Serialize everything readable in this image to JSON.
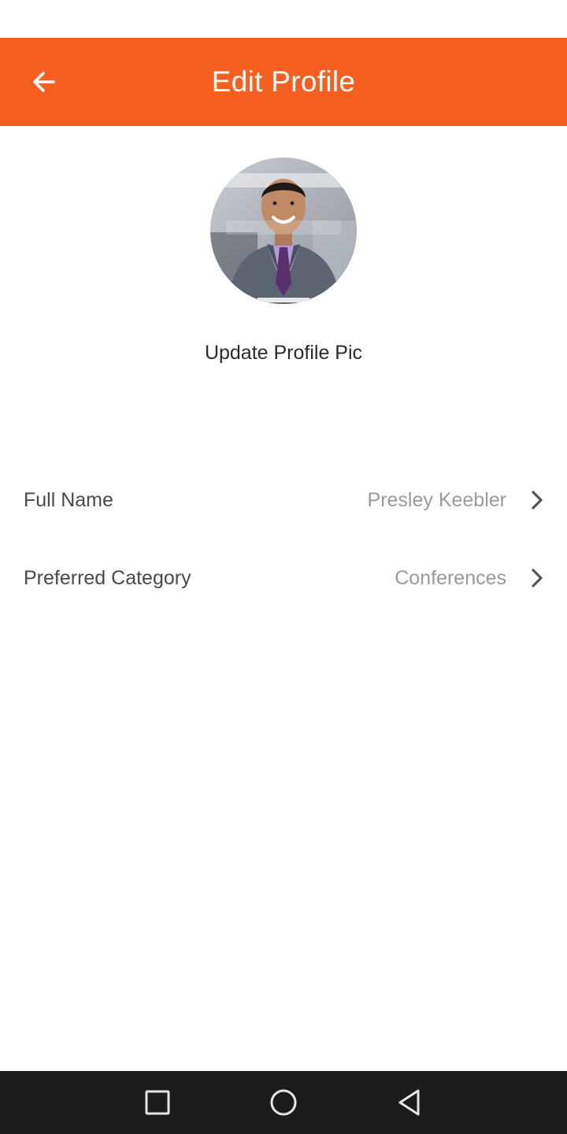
{
  "app_bar": {
    "title": "Edit Profile",
    "background_color": "#f55f1f",
    "back_icon": "arrow-left-icon"
  },
  "profile": {
    "avatar_icon": "profile-photo",
    "update_pic_label": "Update Profile Pic"
  },
  "fields": [
    {
      "label": "Full Name",
      "value": "Presley Keebler",
      "icon": "chevron-right-icon"
    },
    {
      "label": "Preferred Category",
      "value": "Conferences",
      "icon": "chevron-right-icon"
    }
  ],
  "nav_bar": {
    "background_color": "#1c1c1c",
    "buttons": [
      "recents-square-icon",
      "home-circle-icon",
      "back-triangle-icon"
    ]
  }
}
